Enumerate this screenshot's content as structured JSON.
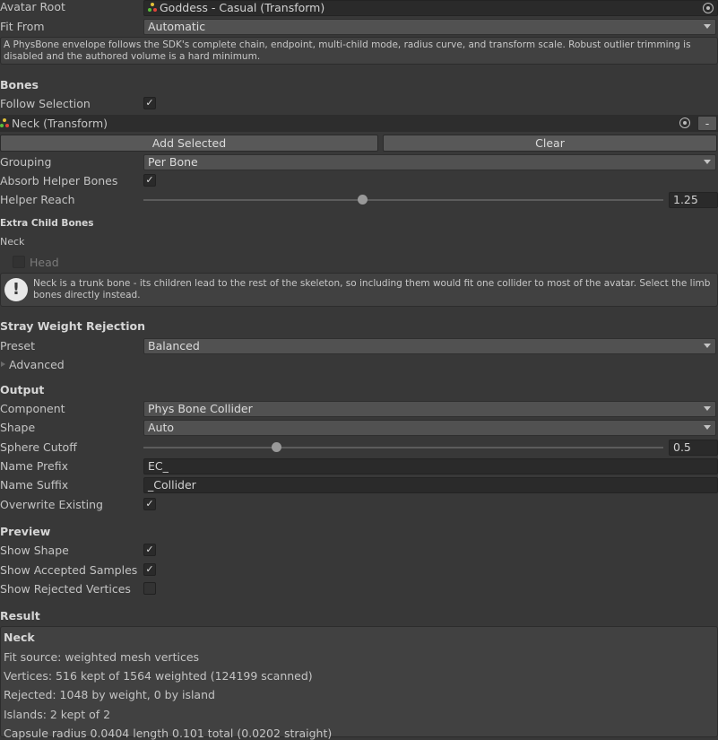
{
  "avatar_root": {
    "label": "Avatar Root",
    "value": "Goddess - Casual (Transform)"
  },
  "fit_from": {
    "label": "Fit From",
    "value": "Automatic"
  },
  "info_text": "A PhysBone envelope follows the SDK's complete chain, endpoint, multi-child mode, radius curve, and transform scale. Robust outlier trimming is disabled and the authored volume is a hard minimum.",
  "bones": {
    "header": "Bones",
    "follow_selection_label": "Follow Selection",
    "follow_selection_checked": true,
    "bone_list_item": "Neck (Transform)",
    "remove_button": "-",
    "add_selected": "Add Selected",
    "clear": "Clear",
    "grouping_label": "Grouping",
    "grouping_value": "Per Bone",
    "absorb_label": "Absorb Helper Bones",
    "absorb_checked": true,
    "helper_reach_label": "Helper Reach",
    "helper_reach_value": "1.25",
    "helper_reach_fraction": 0.42
  },
  "extra_child": {
    "header": "Extra Child Bones",
    "parent": "Neck",
    "child": "Head",
    "child_checked": false,
    "warning": "Neck is a trunk bone - its children lead to the rest of the skeleton, so including them would fit one collider to most of the avatar. Select the limb bones directly instead."
  },
  "stray": {
    "header": "Stray Weight Rejection",
    "preset_label": "Preset",
    "preset_value": "Balanced",
    "advanced_label": "Advanced"
  },
  "output": {
    "header": "Output",
    "component_label": "Component",
    "component_value": "Phys Bone Collider",
    "shape_label": "Shape",
    "shape_value": "Auto",
    "sphere_cutoff_label": "Sphere Cutoff",
    "sphere_cutoff_value": "0.5",
    "sphere_cutoff_fraction": 0.255,
    "name_prefix_label": "Name Prefix",
    "name_prefix_value": "EC_",
    "name_suffix_label": "Name Suffix",
    "name_suffix_value": "_Collider",
    "overwrite_label": "Overwrite Existing",
    "overwrite_checked": true
  },
  "preview": {
    "header": "Preview",
    "show_shape_label": "Show Shape",
    "show_shape_checked": true,
    "show_accepted_label": "Show Accepted Samples",
    "show_accepted_checked": true,
    "show_rejected_label": "Show Rejected Vertices",
    "show_rejected_checked": false
  },
  "result": {
    "header": "Result",
    "title": "Neck",
    "lines": [
      "Fit source: weighted mesh vertices",
      "Vertices: 516 kept of 1564 weighted (124199 scanned)",
      "Rejected: 1048 by weight, 0 by island",
      "Islands: 2 kept of 2",
      "Capsule  radius 0.0404  length 0.101 total  (0.0202 straight)"
    ]
  },
  "colors": {
    "icon_red": "#e0443a",
    "icon_green": "#5bbf3a",
    "icon_yellow": "#e2c23a"
  }
}
